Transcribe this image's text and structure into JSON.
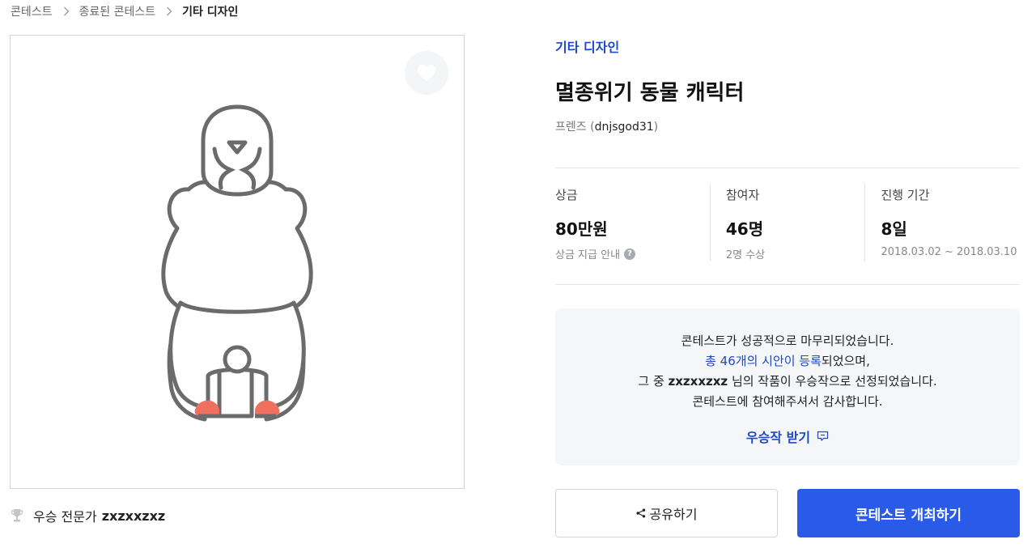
{
  "breadcrumb": {
    "items": [
      "콘테스트",
      "종료된 콘테스트",
      "기타 디자인"
    ]
  },
  "winner": {
    "label": "우승 전문가",
    "name": "zxzxxzxz"
  },
  "contest": {
    "category": "기타 디자인",
    "title": "멸종위기 동물 캐릭터",
    "host_name": "프렌즈",
    "host_id": "dnjsgod31"
  },
  "stats": {
    "prize": {
      "label": "상금",
      "value": "80만원",
      "sub": "상금 지급 안내"
    },
    "participants": {
      "label": "참여자",
      "value": "46명",
      "sub": "2명 수상"
    },
    "period": {
      "label": "진행 기간",
      "value": "8일",
      "sub": "2018.03.02 ~ 2018.03.10"
    }
  },
  "notice": {
    "line1": "콘테스트가 성공적으로 마무리되었습니다.",
    "line2_highlight": "총 46개의 시안이 등록",
    "line2_rest": "되었으며,",
    "line3_prefix": "그 중",
    "line3_id": "zxzxxzxz",
    "line3_suffix": "님의 작품이 우승작으로 선정되었습니다.",
    "line4": "콘테스트에 참여해주셔서 감사합니다.",
    "receive_label": "우승작 받기"
  },
  "buttons": {
    "share_label": "공유하기",
    "host_label": "콘테스트 개최하기"
  },
  "colors": {
    "accent": "#1f49c6",
    "primary_button": "#2a5ae8",
    "feet": "#f0705f",
    "outline": "#6b6b6b"
  },
  "icons": [
    "chevron-right-icon",
    "heart-icon",
    "trophy-icon",
    "help-icon",
    "message-icon",
    "share-icon"
  ]
}
